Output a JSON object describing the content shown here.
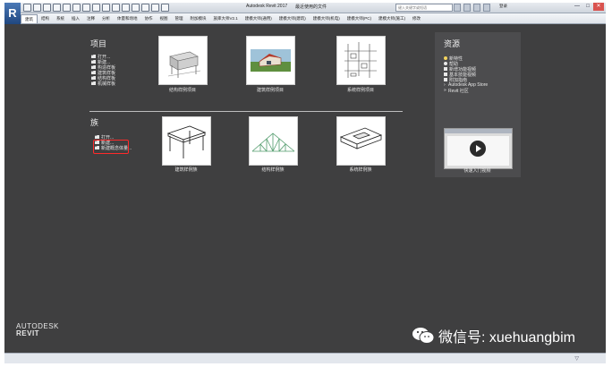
{
  "window": {
    "app_button": "R",
    "title": "Autodesk Revit 2017",
    "doc_title": "最近使用的文件",
    "search_placeholder": "键入关键字或短语",
    "user": "登录",
    "controls": [
      "—",
      "□",
      "✕"
    ]
  },
  "ribbon_tabs": [
    "建筑",
    "结构",
    "系统",
    "插入",
    "注释",
    "分析",
    "体量和场地",
    "协作",
    "视图",
    "管理",
    "附加模块",
    "族库大师V2.1",
    "建模大师(通用)",
    "建模大师(建筑)",
    "建模大师(机电)",
    "建模大师(PC)",
    "建模大师(施工)",
    "修改"
  ],
  "projects": {
    "title": "项目",
    "links": [
      "打开...",
      "新建...",
      "构造样板",
      "建筑样板",
      "结构样板",
      "机械样板"
    ],
    "thumbs": [
      {
        "caption": "结构样例项目",
        "icon": "structure-house-icon"
      },
      {
        "caption": "建筑样例项目",
        "icon": "architecture-house-icon"
      },
      {
        "caption": "系统样例项目",
        "icon": "mep-system-icon"
      }
    ]
  },
  "families": {
    "title": "族",
    "links": [
      "打开...",
      "新建...",
      "新建概念体量..."
    ],
    "thumbs": [
      {
        "caption": "建筑样例族",
        "icon": "table-icon"
      },
      {
        "caption": "结构样例族",
        "icon": "truss-icon"
      },
      {
        "caption": "系统样例族",
        "icon": "duct-icon"
      }
    ]
  },
  "resources": {
    "title": "资源",
    "links": [
      "新特性",
      "帮助",
      "新增功能视频",
      "基本技能视频",
      "附加指南",
      "Autodesk App Store",
      "Revit 社区"
    ],
    "video_caption": "快速入门视频"
  },
  "brand": {
    "line1": "AUTODESK",
    "line2": "REVIT"
  },
  "watermark": "微信号: xuehuangbim",
  "colors": {
    "background": "#3f3f40",
    "panel": "#4c4c4e",
    "highlight": "#ff2a2a"
  }
}
